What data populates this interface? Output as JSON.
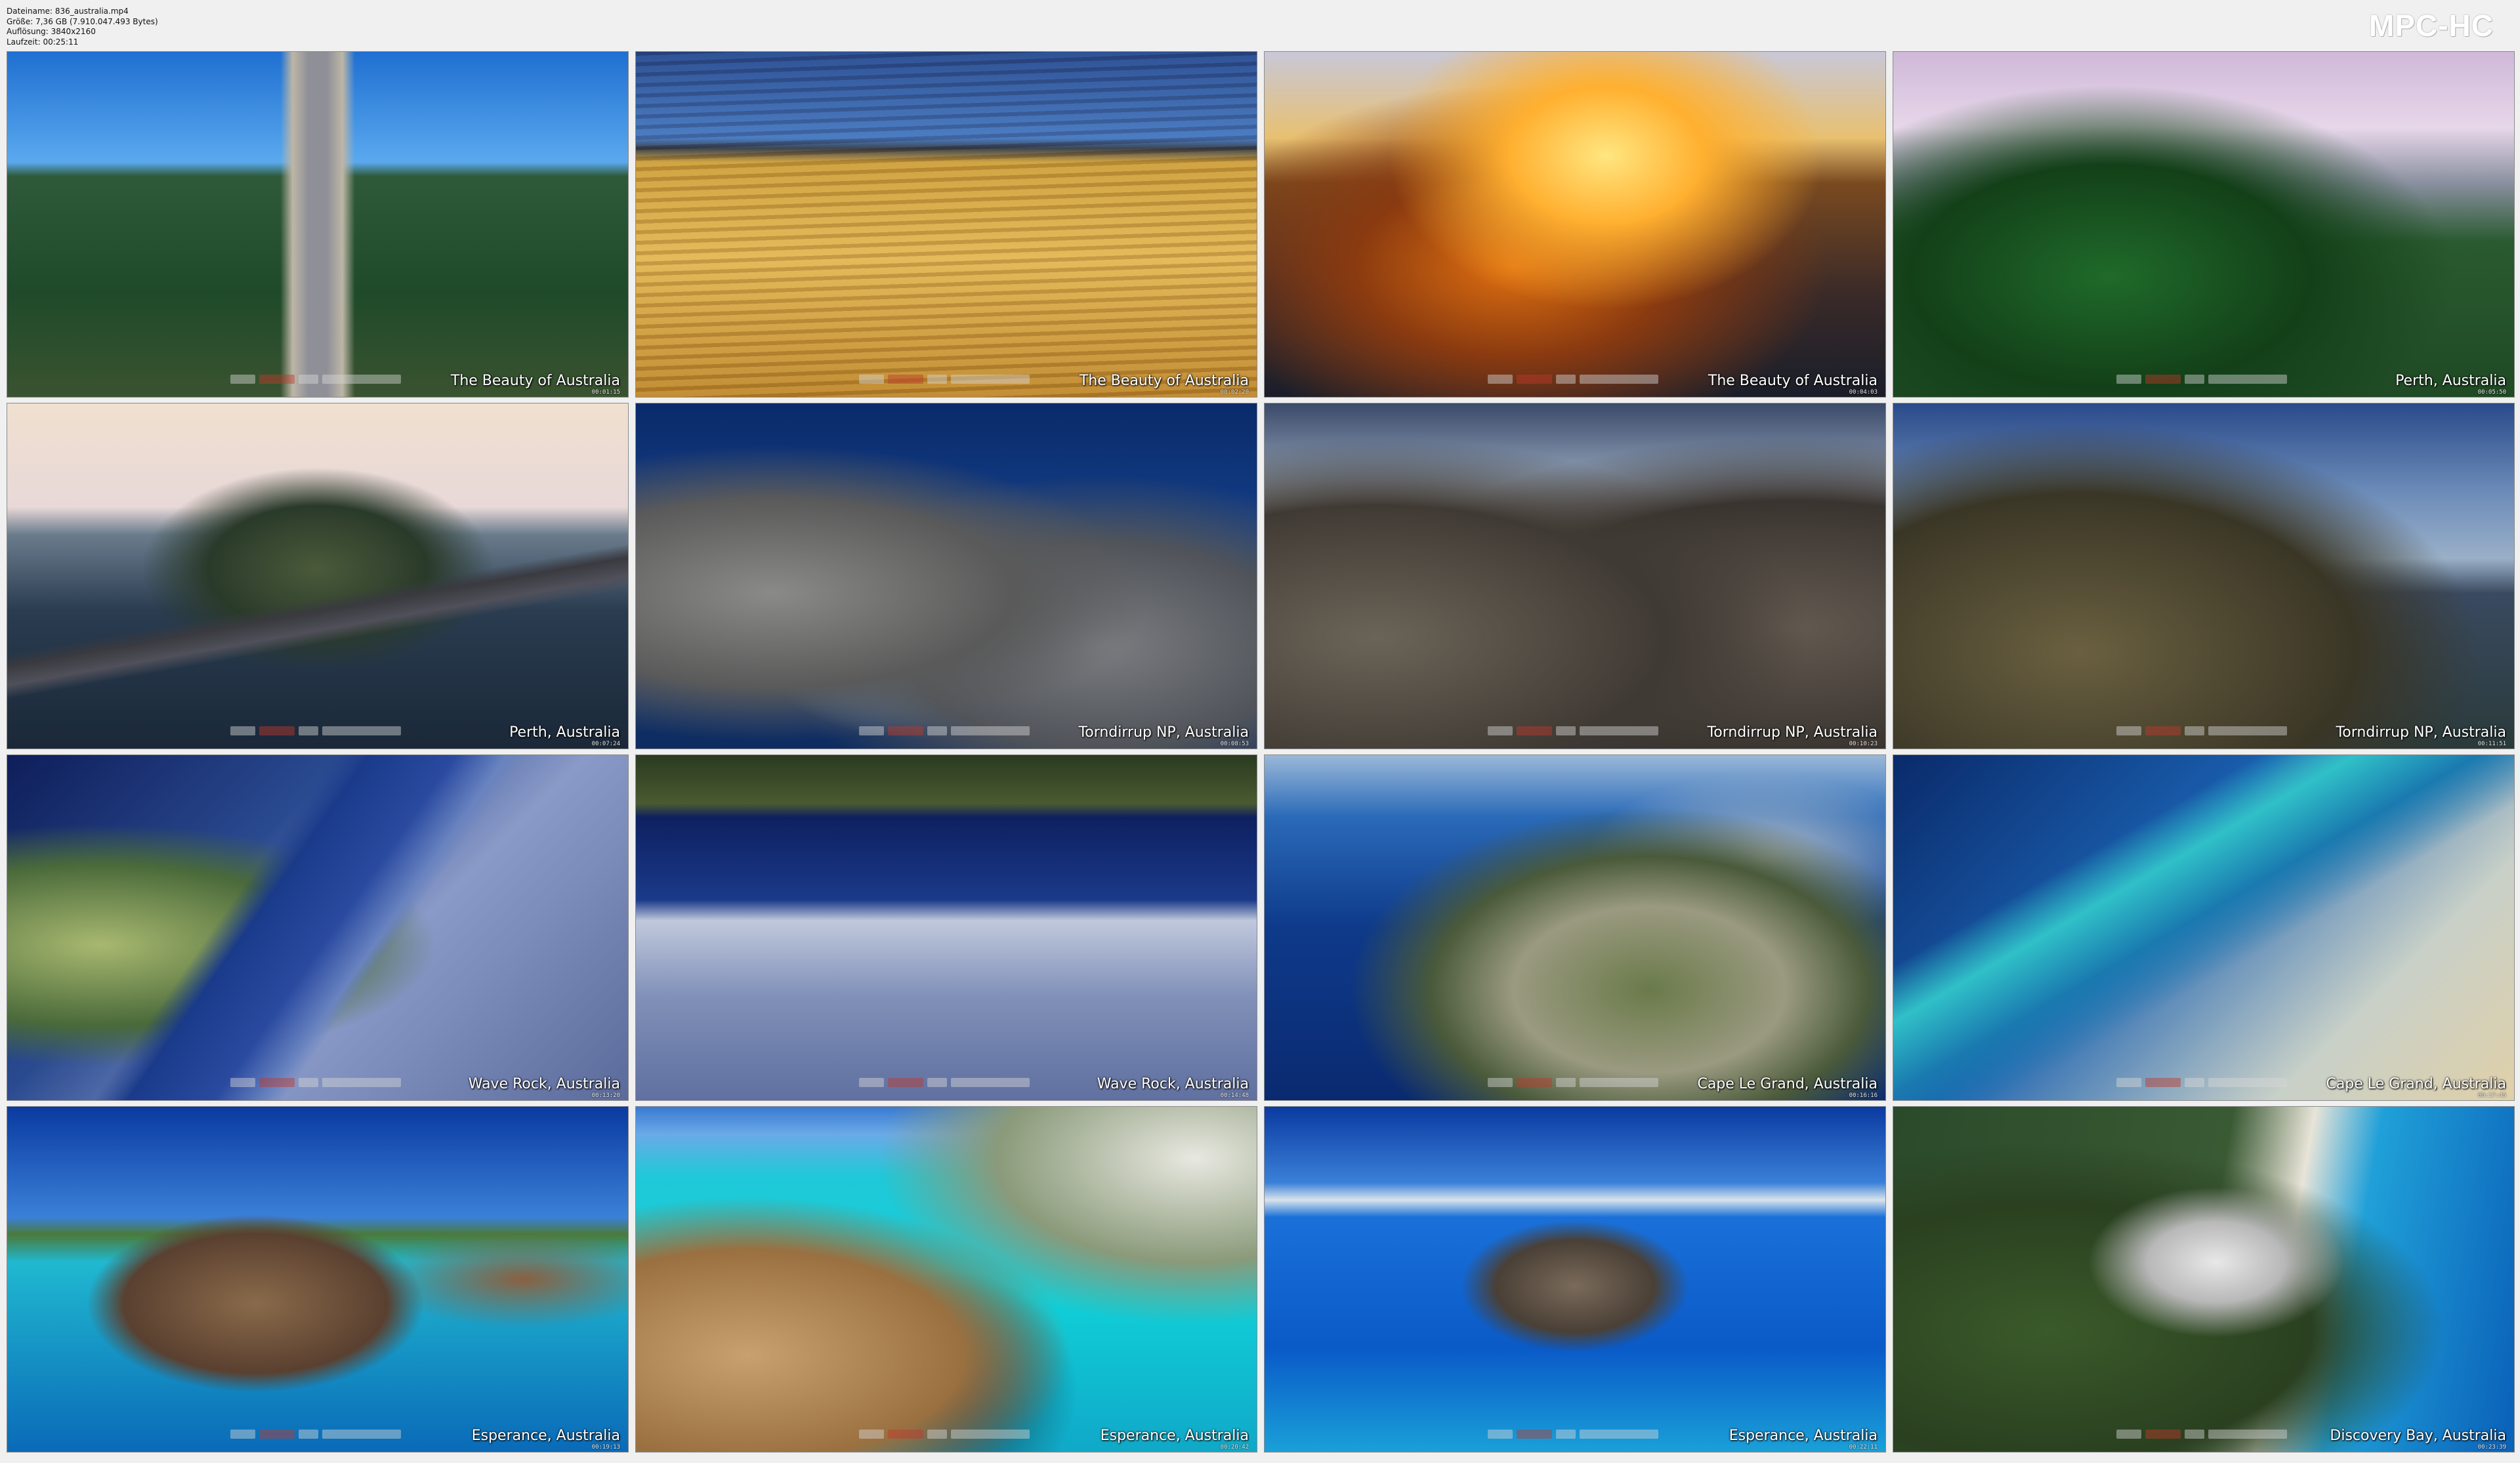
{
  "header": {
    "file_info_lines": [
      "Dateiname: 836_australia.mp4",
      "Größe: 7,36 GB (7.910.047.493 Bytes)",
      "Auflösung: 3840x2160",
      "Laufzeit: 00:25:11"
    ],
    "app_logo": "MPC-HC",
    "logo_color": "#ffffff"
  },
  "thumbnails": [
    {
      "caption": "The Beauty of Australia",
      "timecode": "00:01:15",
      "scene": "road"
    },
    {
      "caption": "The Beauty of Australia",
      "timecode": "00:02:20",
      "scene": "field"
    },
    {
      "caption": "The Beauty of Australia",
      "timecode": "00:04:03",
      "scene": "sunset"
    },
    {
      "caption": "Perth, Australia",
      "timecode": "00:05:50",
      "scene": "perth"
    },
    {
      "caption": "Perth, Australia",
      "timecode": "00:07:24",
      "scene": "bridge"
    },
    {
      "caption": "Torndirrup NP, Australia",
      "timecode": "00:08:53",
      "scene": "cliff1"
    },
    {
      "caption": "Torndirrup NP, Australia",
      "timecode": "00:10:23",
      "scene": "cliff2"
    },
    {
      "caption": "Torndirrup NP, Australia",
      "timecode": "00:11:51",
      "scene": "cliff3"
    },
    {
      "caption": "Wave Rock, Australia",
      "timecode": "00:13:20",
      "scene": "wave1"
    },
    {
      "caption": "Wave Rock, Australia",
      "timecode": "00:14:48",
      "scene": "wave2"
    },
    {
      "caption": "Cape Le Grand, Australia",
      "timecode": "00:16:16",
      "scene": "cape1"
    },
    {
      "caption": "Cape Le Grand, Australia",
      "timecode": "00:17:45",
      "scene": "cape2"
    },
    {
      "caption": "Esperance, Australia",
      "timecode": "00:19:13",
      "scene": "esp1"
    },
    {
      "caption": "Esperance, Australia",
      "timecode": "00:20:42",
      "scene": "esp2"
    },
    {
      "caption": "Esperance, Australia",
      "timecode": "00:22:11",
      "scene": "esp3"
    },
    {
      "caption": "Discovery Bay, Australia",
      "timecode": "00:23:39",
      "scene": "disc"
    }
  ]
}
